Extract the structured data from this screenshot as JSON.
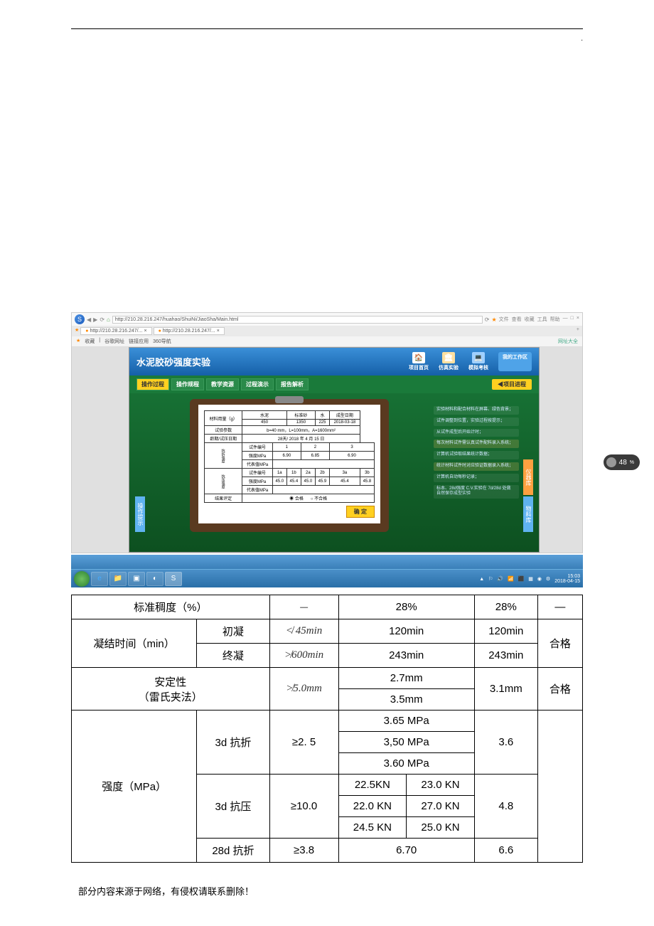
{
  "browser": {
    "url": "http://210.28.216.247/huahao/ShuiNi/JiaoSha/Main.html",
    "right_labels": [
      "文件",
      "查看",
      "收藏",
      "工具",
      "帮助"
    ],
    "tabs": [
      {
        "label": "http://210.28.216.247/...",
        "close": "×"
      },
      {
        "label": "http://210.28.216.247/...",
        "close": "×"
      }
    ],
    "bookmarks": [
      "收藏",
      "谷歌网址",
      "链接应用",
      "360导航"
    ],
    "site_link": "网址大全"
  },
  "app": {
    "title": "水泥胶砂强度实验",
    "nav": [
      {
        "label": "项目首页",
        "name": "home-icon"
      },
      {
        "label": "仿真实验",
        "name": "lab-icon"
      },
      {
        "label": "模拟考核",
        "name": "exam-icon"
      }
    ],
    "login_btn": "我的工作区",
    "tabs": [
      "操作过程",
      "操作规程",
      "教学资源",
      "过程演示",
      "报告解析"
    ],
    "proj_btn": "◀项目进程",
    "side_left": "操作提示",
    "side_right1": "仪器库",
    "side_right2": "物料库",
    "submit": "确 定",
    "tips": [
      "实验材料和配合材料在屏幕、绿色背景；",
      "试件调整到位置，实验过程按提示；",
      "从试件成型后开始计时；",
      "每次材料试件需认真试件配料录入系统；",
      "计算机试验取结果统计数据；",
      "统计材料试件时对应验证数据录入系统；",
      "计算机自动每秒记录；",
      "标本、28d强度 C.V.实验在 7d/28d 处做 自然保存成型实验"
    ]
  },
  "mini": {
    "h_mat": "材料用量（g）",
    "h_cement": "水泥",
    "h_sand": "标准砂",
    "h_water": "水",
    "h_date": "成型日期",
    "v_cement": "450",
    "v_sand": "1350",
    "v_water": "225",
    "v_date": "2018-03-18",
    "h_param": "试验参数",
    "v_param": "b=40 mm，L=100mm，A=1600mm²",
    "h_age": "龄期/试压日期",
    "v_age": "28天/ 2018 年 4 月 15 日",
    "g_flex": "抗折强度",
    "g_comp": "抗压强度",
    "h_spec": "试件编号",
    "h_str": "强度MPa",
    "h_rep": "代表值MPa",
    "flex_ids": [
      "1",
      "2",
      "3"
    ],
    "flex_vals": [
      "6.90",
      "6.85",
      "6.90"
    ],
    "comp_ids": [
      "1a",
      "1b",
      "2a",
      "2b",
      "3a",
      "3b"
    ],
    "comp_vals": [
      "45.0",
      "45.4",
      "45.0",
      "45.9",
      "45.4",
      "45.8"
    ],
    "h_judge": "结果评定",
    "j_pass": "合格",
    "j_fail": "不合格"
  },
  "badge": {
    "num": "48",
    "sub": "%"
  },
  "table": {
    "r1": {
      "c1": "标准稠度（%）",
      "c2": "—",
      "c3": "28%",
      "c4": "28%",
      "c5": "—"
    },
    "setting": {
      "label": "凝结时间（min）",
      "init": "初凝",
      "final": "终凝",
      "init_std": "≮ 45min",
      "init_v": "120min",
      "init_r": "120min",
      "final_std": "≯600min",
      "final_v": "243min",
      "final_r": "243min",
      "pass": "合格"
    },
    "stab": {
      "l1": "安定性",
      "l2": "（雷氏夹法）",
      "std": "≯5.0mm",
      "v1": "2.7mm",
      "v2": "3.5mm",
      "r": "3.1mm",
      "pass": "合格"
    },
    "str": {
      "label": "强度（MPa）",
      "flex3": {
        "name": "3d 抗折",
        "std": "≥2. 5",
        "v": [
          "3.65 MPa",
          "3,50 MPa",
          "3.60 MPa"
        ],
        "r": "3.6"
      },
      "comp3": {
        "name": "3d 抗压",
        "std": "≥10.0",
        "v": [
          [
            "22.5KN",
            "23.0 KN"
          ],
          [
            "22.0 KN",
            "27.0 KN"
          ],
          [
            "24.5 KN",
            "25.0 KN"
          ]
        ],
        "r": "4.8"
      },
      "flex28": {
        "name": "28d 抗折",
        "std": "≥3.8",
        "v": "6.70",
        "r": "6.6"
      }
    }
  },
  "tray": {
    "time": "15:03",
    "date": "2018-04-15"
  },
  "footer": "部分内容来源于网络，有侵权请联系删除！"
}
